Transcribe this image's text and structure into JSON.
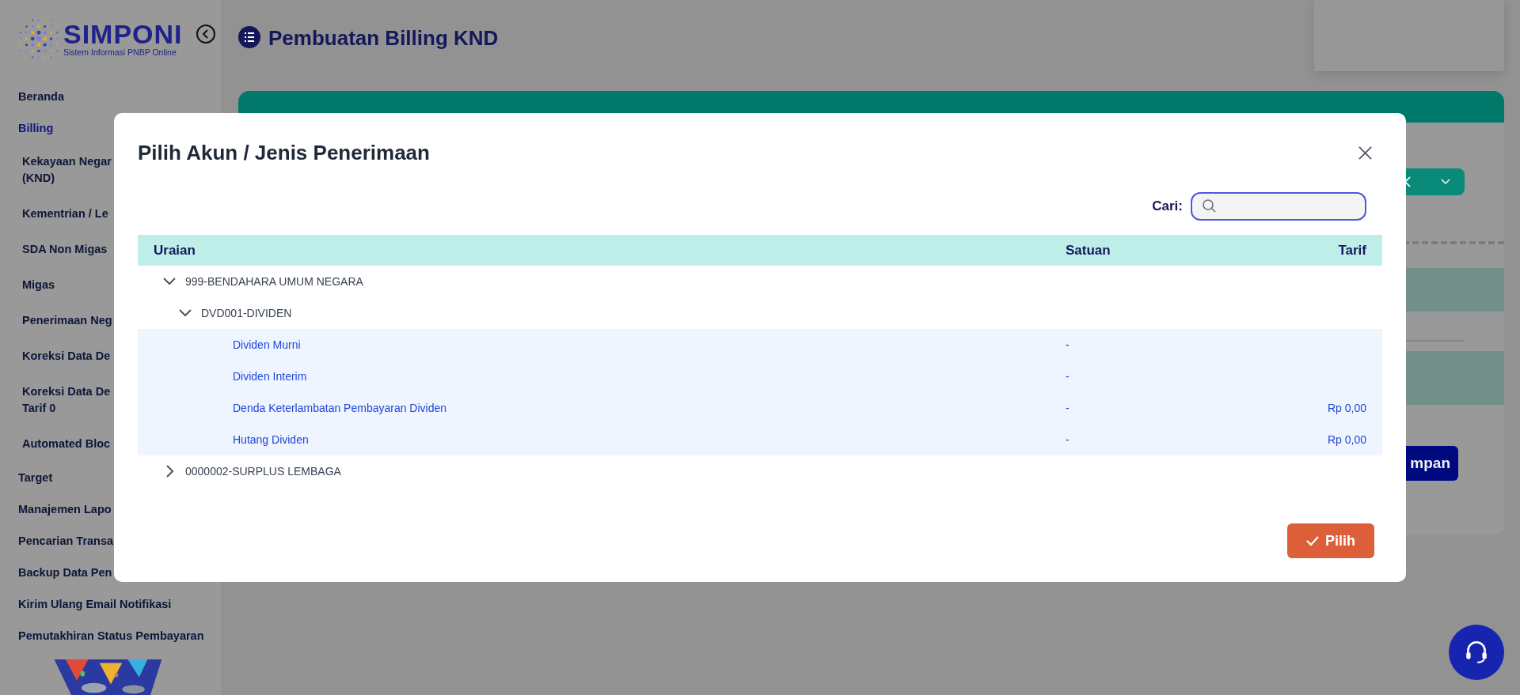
{
  "logo": {
    "name": "SIMPONI",
    "subtitle": "Sistem Informasi PNBP Online"
  },
  "sidebar": {
    "items": [
      {
        "label": "Beranda",
        "selected": false
      },
      {
        "label": "Billing",
        "selected": true,
        "children": [
          {
            "lines": [
              "Kekayaan Negar",
              "(KND)"
            ]
          },
          {
            "lines": [
              "Kementrian / Le"
            ]
          },
          {
            "lines": [
              "SDA Non Migas"
            ]
          },
          {
            "lines": [
              "Migas"
            ]
          },
          {
            "lines": [
              "Penerimaan Neg"
            ]
          },
          {
            "lines": [
              "Koreksi Data De"
            ]
          },
          {
            "lines": [
              "Koreksi Data De",
              "Tarif 0"
            ]
          },
          {
            "lines": [
              "Automated Bloc"
            ]
          }
        ]
      },
      {
        "label": "Target",
        "selected": false
      },
      {
        "label": "Manajemen Lapo",
        "selected": false
      },
      {
        "label": "Pencarian Transa",
        "selected": false
      },
      {
        "label": "Backup Data Pen",
        "selected": false
      },
      {
        "label": "Kirim Ulang Email Notifikasi",
        "selected": false
      },
      {
        "label": "Pemutakhiran Status Pembayaran",
        "selected": false
      }
    ]
  },
  "page": {
    "title": "Pembuatan Billing KND",
    "save_button": "mpan"
  },
  "modal": {
    "title": "Pilih Akun / Jenis Penerimaan",
    "search_label": "Cari:",
    "columns": [
      "Uraian",
      "Satuan",
      "Tarif"
    ],
    "tree": [
      {
        "kind": "group",
        "label": "999-BENDAHARA UMUM NEGARA",
        "expanded": true,
        "children": [
          {
            "kind": "group",
            "label": "DVD001-DIVIDEN",
            "expanded": true,
            "children": [
              {
                "kind": "account",
                "label": "Dividen Murni",
                "satuan": "-"
              },
              {
                "kind": "account",
                "label": "Dividen Interim",
                "satuan": "-"
              },
              {
                "kind": "account",
                "label": "Denda Keterlambatan Pembayaran Dividen",
                "satuan": "-",
                "tarif": "Rp 0,00"
              },
              {
                "kind": "account",
                "label": "Hutang Dividen",
                "satuan": "-",
                "tarif": "Rp 0,00"
              }
            ]
          }
        ]
      },
      {
        "kind": "group",
        "label": "0000002-SURPLUS LEMBAGA",
        "expanded": false
      }
    ],
    "confirm_button": "Pilih"
  }
}
